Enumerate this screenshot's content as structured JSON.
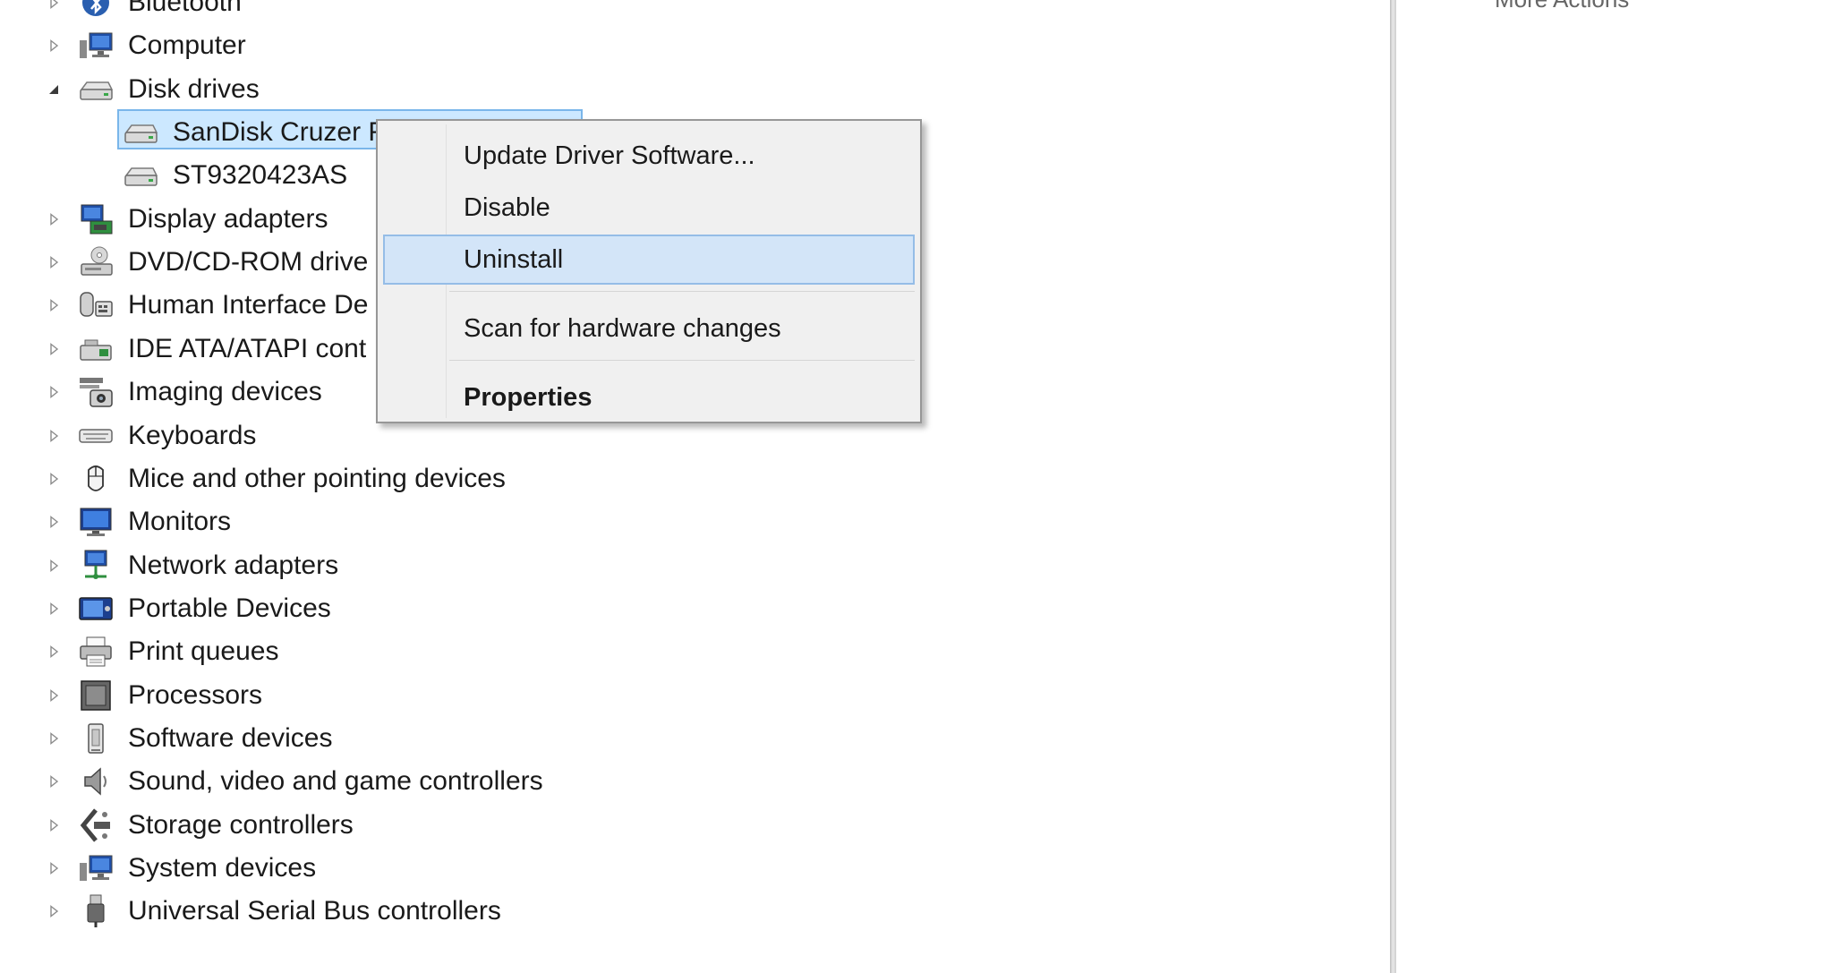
{
  "tree": {
    "items": [
      {
        "label": "Bluetooth",
        "level": 0,
        "expanded": false,
        "icon": "bluetooth-icon"
      },
      {
        "label": "Computer",
        "level": 0,
        "expanded": false,
        "icon": "computer-icon"
      },
      {
        "label": "Disk drives",
        "level": 0,
        "expanded": true,
        "icon": "disk-drive-icon"
      },
      {
        "label": "SanDisk Cruzer F",
        "level": 1,
        "selected": true,
        "icon": "disk-drive-icon"
      },
      {
        "label": "ST9320423AS",
        "level": 1,
        "icon": "disk-drive-icon"
      },
      {
        "label": "Display adapters",
        "level": 0,
        "expanded": false,
        "icon": "display-adapter-icon"
      },
      {
        "label": "DVD/CD-ROM drive",
        "level": 0,
        "expanded": false,
        "icon": "dvd-drive-icon"
      },
      {
        "label": "Human Interface De",
        "level": 0,
        "expanded": false,
        "icon": "hid-icon"
      },
      {
        "label": "IDE ATA/ATAPI cont",
        "level": 0,
        "expanded": false,
        "icon": "ide-controller-icon"
      },
      {
        "label": "Imaging devices",
        "level": 0,
        "expanded": false,
        "icon": "imaging-device-icon"
      },
      {
        "label": "Keyboards",
        "level": 0,
        "expanded": false,
        "icon": "keyboard-icon"
      },
      {
        "label": "Mice and other pointing devices",
        "level": 0,
        "expanded": false,
        "icon": "mouse-icon"
      },
      {
        "label": "Monitors",
        "level": 0,
        "expanded": false,
        "icon": "monitor-icon"
      },
      {
        "label": "Network adapters",
        "level": 0,
        "expanded": false,
        "icon": "network-adapter-icon"
      },
      {
        "label": "Portable Devices",
        "level": 0,
        "expanded": false,
        "icon": "portable-device-icon"
      },
      {
        "label": "Print queues",
        "level": 0,
        "expanded": false,
        "icon": "printer-icon"
      },
      {
        "label": "Processors",
        "level": 0,
        "expanded": false,
        "icon": "processor-icon"
      },
      {
        "label": "Software devices",
        "level": 0,
        "expanded": false,
        "icon": "software-device-icon"
      },
      {
        "label": "Sound, video and game controllers",
        "level": 0,
        "expanded": false,
        "icon": "speaker-icon"
      },
      {
        "label": "Storage controllers",
        "level": 0,
        "expanded": false,
        "icon": "storage-controller-icon"
      },
      {
        "label": "System devices",
        "level": 0,
        "expanded": false,
        "icon": "system-device-icon"
      },
      {
        "label": "Universal Serial Bus controllers",
        "level": 0,
        "expanded": false,
        "icon": "usb-icon"
      }
    ]
  },
  "context_menu": {
    "items": [
      {
        "label": "Update Driver Software...",
        "hovered": false,
        "bold": false
      },
      {
        "label": "Disable",
        "hovered": false,
        "bold": false
      },
      {
        "label": "Uninstall",
        "hovered": true,
        "bold": false
      },
      {
        "label": "Scan for hardware changes",
        "hovered": false,
        "bold": false
      },
      {
        "label": "Properties",
        "hovered": false,
        "bold": true
      }
    ]
  },
  "right_pane": {
    "cut_text": "More Actions"
  },
  "colors": {
    "selection_fill": "#cce8ff",
    "selection_border": "#7ab6ea",
    "menu_background": "#f0f0f0",
    "menu_hover_fill": "#d3e5f8",
    "menu_hover_border": "#95bde7"
  }
}
